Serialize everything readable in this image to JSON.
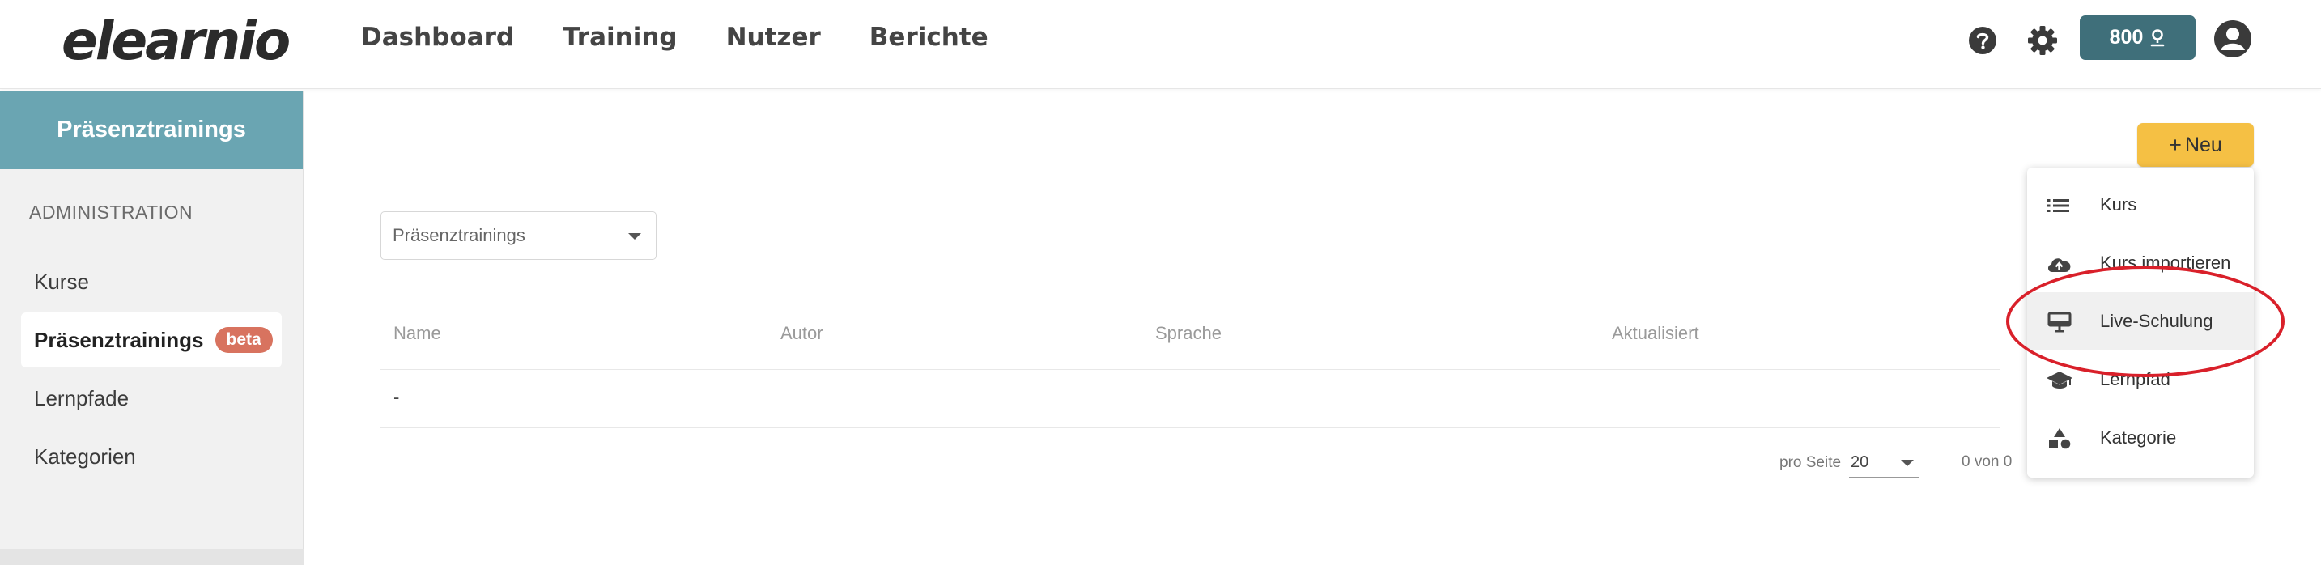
{
  "app": {
    "logo": "elearnio"
  },
  "nav": {
    "items": [
      "Dashboard",
      "Training",
      "Nutzer",
      "Berichte"
    ]
  },
  "header": {
    "credits_label": "800",
    "icons": [
      "help-icon",
      "gear-icon",
      "credit-icon",
      "user-avatar-icon"
    ]
  },
  "sidebar": {
    "title": "Präsenztrainings",
    "section_label": "ADMINISTRATION",
    "items": [
      {
        "label": "Kurse",
        "active": false
      },
      {
        "label": "Präsenztrainings",
        "active": true,
        "badge": "beta"
      },
      {
        "label": "Lernpfade",
        "active": false
      },
      {
        "label": "Kategorien",
        "active": false
      }
    ]
  },
  "main": {
    "new_button": {
      "icon": "plus-icon",
      "label": "Neu"
    },
    "filter": {
      "value": "Präsenztrainings"
    },
    "table": {
      "columns": [
        "Name",
        "Autor",
        "Sprache",
        "Aktualisiert"
      ],
      "rows": [
        [
          "-"
        ]
      ]
    },
    "pagination": {
      "per_page_label": "pro Seite",
      "per_page_value": "20",
      "count": "0 von 0"
    }
  },
  "new_menu": {
    "items": [
      {
        "icon": "list-icon",
        "label": "Kurs"
      },
      {
        "icon": "cloud-upload-icon",
        "label": "Kurs importieren"
      },
      {
        "icon": "presentation-board-icon",
        "label": "Live-Schulung"
      },
      {
        "icon": "graduation-cap-icon",
        "label": "Lernpfad"
      },
      {
        "icon": "shapes-icon",
        "label": "Kategorie"
      }
    ]
  },
  "colors": {
    "brand_teal": "#6aa5b2",
    "credit_button": "#3f6f7a",
    "new_button": "#f5c044",
    "beta_badge": "#d8735f",
    "annotation": "#d9202a"
  }
}
